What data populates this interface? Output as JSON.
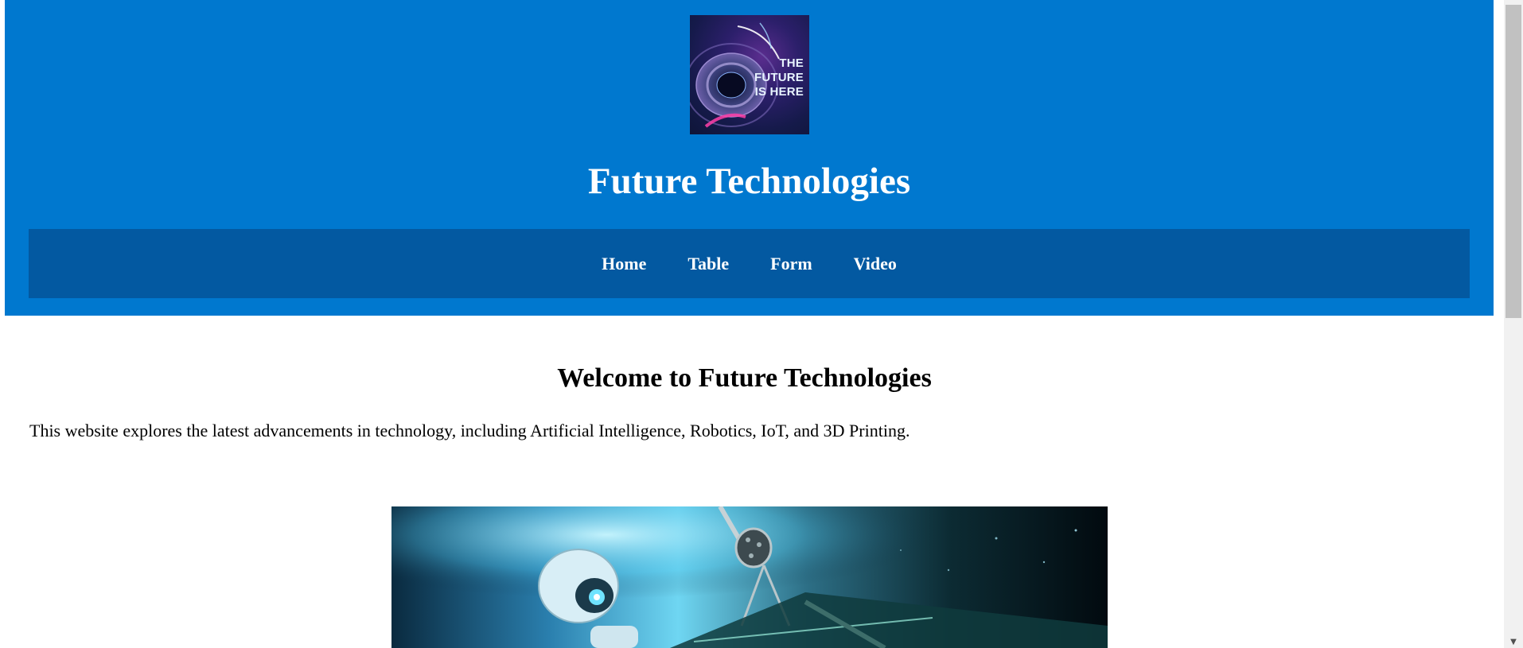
{
  "logo": {
    "text": "THE\nFUTURE\nIS HERE"
  },
  "header": {
    "title": "Future Technologies"
  },
  "nav": {
    "items": [
      "Home",
      "Table",
      "Form",
      "Video"
    ]
  },
  "main": {
    "heading": "Welcome to Future Technologies",
    "intro": "This website explores the latest advancements in technology, including Artificial Intelligence, Robotics, IoT, and 3D Printing."
  },
  "colors": {
    "header_bg": "#0078cf",
    "nav_bg": "#0359a1",
    "text": "#000000",
    "header_text": "#ffffff"
  },
  "icons": {
    "scroll_down": "scroll-down-arrow-icon"
  }
}
